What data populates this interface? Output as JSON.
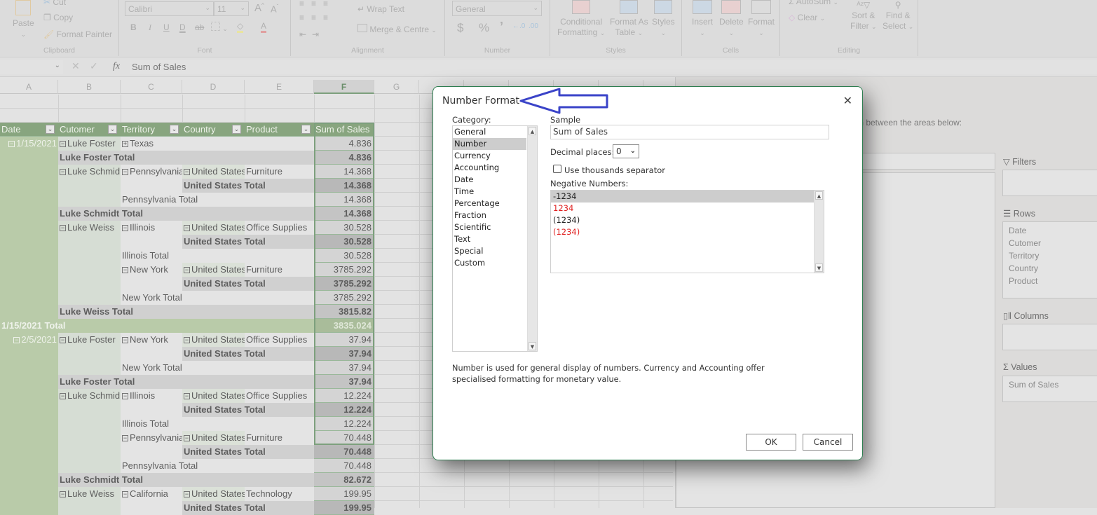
{
  "ribbon": {
    "clipboard": {
      "paste": "Paste",
      "cut": "Cut",
      "copy": "Copy",
      "format_painter": "Format Painter",
      "label": "Clipboard"
    },
    "font": {
      "font_name": "Calibri",
      "font_size": "11",
      "bold": "B",
      "italic": "I",
      "underline": "U",
      "double_underline": "D",
      "strike": "ab",
      "label": "Font"
    },
    "alignment": {
      "wrap_text": "Wrap Text",
      "merge": "Merge & Centre",
      "label": "Alignment"
    },
    "number": {
      "format": "General",
      "currency": "$",
      "percent": "%",
      "comma": "’",
      "inc_dec": "←.0",
      "dec_dec": ".00",
      "label": "Number"
    },
    "styles": {
      "conditional": "Conditional",
      "conditional2": "Formatting",
      "format_as": "Format As",
      "format_as2": "Table",
      "styles": "Styles",
      "label": "Styles"
    },
    "cells": {
      "insert": "Insert",
      "delete": "Delete",
      "format": "Format",
      "label": "Cells"
    },
    "editing": {
      "autosum": "AutoSum",
      "clear": "Clear",
      "sort": "Sort &",
      "sort2": "Filter",
      "find": "Find &",
      "find2": "Select",
      "label": "Editing"
    }
  },
  "formula_bar": {
    "name_box": "",
    "fx": "fx",
    "content": "Sum of Sales"
  },
  "columns": [
    "A",
    "B",
    "C",
    "D",
    "E",
    "F",
    "G"
  ],
  "pivot": {
    "headers": [
      "Date",
      "Cutomer",
      "Territory",
      "Country",
      "Product",
      "Sum of Sales"
    ],
    "rows": [
      {
        "type": "detail",
        "a": "1/15/2021",
        "a_tog": "−",
        "b": "Luke Foster",
        "b_tog": "−",
        "c": "Texas",
        "c_tog": "+",
        "d": "",
        "e": "",
        "f": "4.836"
      },
      {
        "type": "cust-total",
        "b": "Luke Foster Total",
        "f": "4.836"
      },
      {
        "type": "detail",
        "b": "Luke Schmid",
        "b_tog": "−",
        "c": "Pennsylvania",
        "c_tog": "−",
        "d": "United States",
        "d_tog": "−",
        "e": "Furniture",
        "f": "14.368"
      },
      {
        "type": "country-total",
        "d": "United States Total",
        "f": "14.368"
      },
      {
        "type": "terr-total",
        "c": "Pennsylvania Total",
        "f": "14.368"
      },
      {
        "type": "cust-total",
        "b": "Luke Schmidt Total",
        "f": "14.368"
      },
      {
        "type": "detail",
        "b": "Luke Weiss",
        "b_tog": "−",
        "c": "Illinois",
        "c_tog": "−",
        "d": "United States",
        "d_tog": "−",
        "e": "Office Supplies",
        "f": "30.528"
      },
      {
        "type": "country-total",
        "d": "United States Total",
        "f": "30.528"
      },
      {
        "type": "terr-total",
        "c": "Illinois Total",
        "f": "30.528"
      },
      {
        "type": "detail",
        "c": "New York",
        "c_tog": "−",
        "d": "United States",
        "d_tog": "−",
        "e": "Furniture",
        "f": "3785.292"
      },
      {
        "type": "country-total",
        "d": "United States Total",
        "f": "3785.292"
      },
      {
        "type": "terr-total",
        "c": "New York Total",
        "f": "3785.292"
      },
      {
        "type": "cust-total",
        "b": "Luke Weiss Total",
        "f": "3815.82"
      },
      {
        "type": "date-total",
        "a": "1/15/2021 Total",
        "f": "3835.024"
      },
      {
        "type": "detail",
        "a": "2/5/2021",
        "a_tog": "−",
        "b": "Luke Foster",
        "b_tog": "−",
        "c": "New York",
        "c_tog": "−",
        "d": "United States",
        "d_tog": "−",
        "e": "Office Supplies",
        "f": "37.94"
      },
      {
        "type": "country-total",
        "d": "United States Total",
        "f": "37.94"
      },
      {
        "type": "terr-total",
        "c": "New York Total",
        "f": "37.94"
      },
      {
        "type": "cust-total",
        "b": "Luke Foster Total",
        "f": "37.94"
      },
      {
        "type": "detail",
        "b": "Luke Schmid",
        "b_tog": "−",
        "c": "Illinois",
        "c_tog": "−",
        "d": "United States",
        "d_tog": "−",
        "e": "Office Supplies",
        "f": "12.224"
      },
      {
        "type": "country-total",
        "d": "United States Total",
        "f": "12.224"
      },
      {
        "type": "terr-total",
        "c": "Illinois Total",
        "f": "12.224"
      },
      {
        "type": "detail",
        "c": "Pennsylvania",
        "c_tog": "−",
        "d": "United States",
        "d_tog": "−",
        "e": "Furniture",
        "f": "70.448"
      },
      {
        "type": "country-total",
        "d": "United States Total",
        "f": "70.448"
      },
      {
        "type": "terr-total",
        "c": "Pennsylvania Total",
        "f": "70.448"
      },
      {
        "type": "cust-total",
        "b": "Luke Schmidt Total",
        "f": "82.672"
      },
      {
        "type": "detail",
        "b": "Luke Weiss",
        "b_tog": "−",
        "c": "California",
        "c_tog": "−",
        "d": "United States",
        "d_tog": "−",
        "e": "Technology",
        "f": "199.95"
      },
      {
        "type": "country-total",
        "d": "United States Total",
        "f": "199.95"
      }
    ]
  },
  "field_pane": {
    "instruction": "m between the areas below:",
    "filters_label": "Filters",
    "rows_label": "Rows",
    "rows_items": [
      "Date",
      "Cutomer",
      "Territory",
      "Country",
      "Product"
    ],
    "columns_label": "Columns",
    "values_label": "Values",
    "values_items": [
      "Sum of Sales"
    ]
  },
  "dialog": {
    "title": "Number Format",
    "close": "✕",
    "category_label": "Category:",
    "categories": [
      "General",
      "Number",
      "Currency",
      "Accounting",
      "Date",
      "Time",
      "Percentage",
      "Fraction",
      "Scientific",
      "Text",
      "Special",
      "Custom"
    ],
    "selected_category": "Number",
    "sample_label": "Sample",
    "sample_value": "Sum of Sales",
    "decimal_label": "Decimal places:",
    "decimal_value": "0",
    "thousands_label": "Use thousands separator",
    "thousands_checked": false,
    "negative_label": "Negative Numbers:",
    "negative_options": [
      {
        "text": "-1234",
        "color": "#222222",
        "selected": true
      },
      {
        "text": "1234",
        "color": "#e02020",
        "selected": false
      },
      {
        "text": "(1234)",
        "color": "#222222",
        "selected": false
      },
      {
        "text": "(1234)",
        "color": "#e02020",
        "selected": false
      }
    ],
    "description": "Number is used for general display of numbers. Currency and Accounting offer specialised formatting for monetary value.",
    "ok": "OK",
    "cancel": "Cancel"
  },
  "annotation": {
    "arrow_color": "#3a43c8"
  }
}
